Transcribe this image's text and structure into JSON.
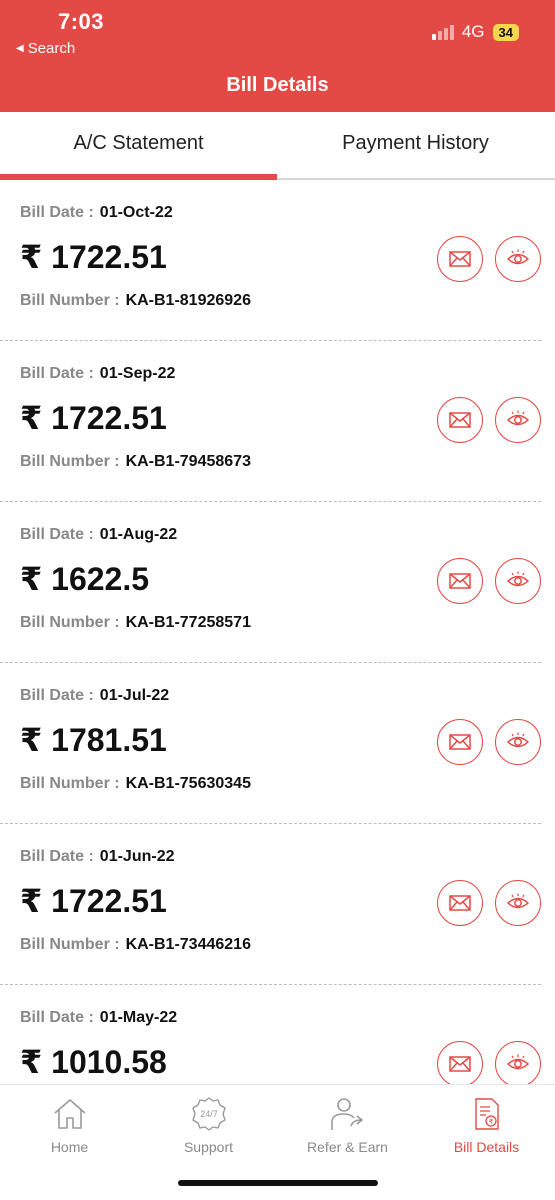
{
  "status_bar": {
    "time": "7:03",
    "back_label": "Search",
    "network": "4G",
    "battery": "34"
  },
  "header": {
    "title": "Bill Details"
  },
  "tabs": [
    {
      "label": "A/C Statement",
      "active": true
    },
    {
      "label": "Payment History",
      "active": false
    }
  ],
  "labels": {
    "bill_date": "Bill Date :",
    "bill_number": "Bill Number :"
  },
  "bills": [
    {
      "date": "01-Oct-22",
      "amount": "₹ 1722.51",
      "number": "KA-B1-81926926"
    },
    {
      "date": "01-Sep-22",
      "amount": "₹ 1722.51",
      "number": "KA-B1-79458673"
    },
    {
      "date": "01-Aug-22",
      "amount": "₹ 1622.5",
      "number": "KA-B1-77258571"
    },
    {
      "date": "01-Jul-22",
      "amount": "₹ 1781.51",
      "number": "KA-B1-75630345"
    },
    {
      "date": "01-Jun-22",
      "amount": "₹ 1722.51",
      "number": "KA-B1-73446216"
    },
    {
      "date": "01-May-22",
      "amount": "₹ 1010.58",
      "number": ""
    }
  ],
  "bottom_nav": [
    {
      "label": "Home",
      "icon": "home-icon",
      "active": false
    },
    {
      "label": "Support",
      "icon": "support-247-icon",
      "active": false
    },
    {
      "label": "Refer & Earn",
      "icon": "refer-earn-icon",
      "active": false
    },
    {
      "label": "Bill Details",
      "icon": "bill-details-icon",
      "active": true
    }
  ],
  "colors": {
    "brand": "#e34a45",
    "battery": "#f6d64c",
    "muted": "#888888"
  }
}
